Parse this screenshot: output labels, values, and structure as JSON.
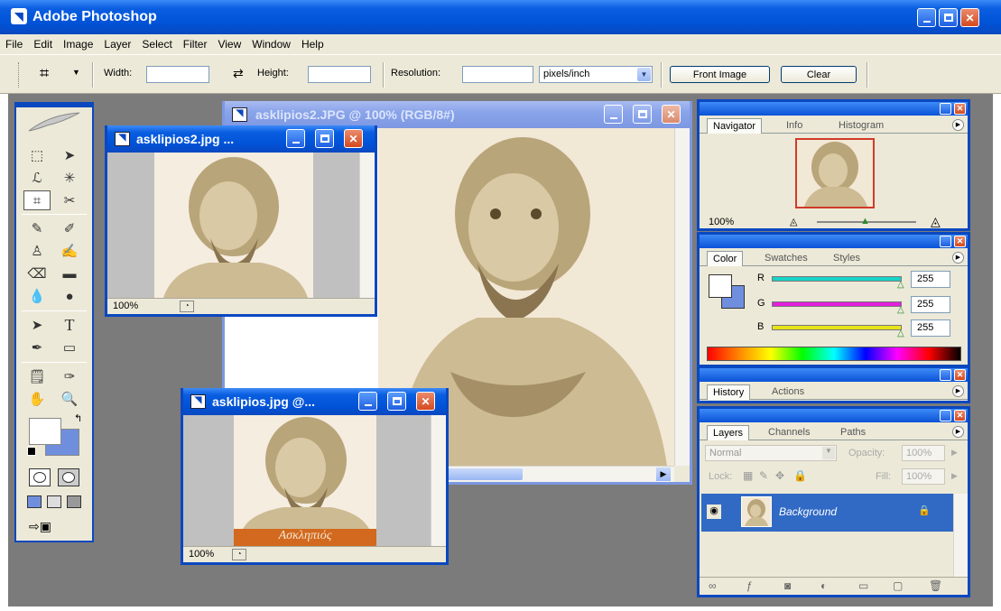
{
  "app": {
    "title": "Adobe Photoshop"
  },
  "menu": [
    "File",
    "Edit",
    "Image",
    "Layer",
    "Select",
    "Filter",
    "View",
    "Window",
    "Help"
  ],
  "options": {
    "width_label": "Width:",
    "height_label": "Height:",
    "resolution_label": "Resolution:",
    "units": "pixels/inch",
    "front_image": "Front Image",
    "clear": "Clear"
  },
  "documents": {
    "main": {
      "title": "asklipios2.JPG @ 100% (RGB/8#)"
    },
    "small1": {
      "title": "asklipios2.jpg ...",
      "zoom": "100%"
    },
    "small2": {
      "title": "asklipios.jpg @...",
      "zoom": "100%",
      "caption": "Ασκληπιός"
    }
  },
  "navigator": {
    "tabs": [
      "Navigator",
      "Info",
      "Histogram"
    ],
    "zoom": "100%"
  },
  "color": {
    "tabs": [
      "Color",
      "Swatches",
      "Styles"
    ],
    "channels": [
      {
        "label": "R",
        "value": "255",
        "color": "#19d2c8"
      },
      {
        "label": "G",
        "value": "255",
        "color": "#e21fdc"
      },
      {
        "label": "B",
        "value": "255",
        "color": "#e8e31a"
      }
    ]
  },
  "history": {
    "tabs": [
      "History",
      "Actions"
    ]
  },
  "layers": {
    "tabs": [
      "Layers",
      "Channels",
      "Paths"
    ],
    "blend_mode": "Normal",
    "opacity_label": "Opacity:",
    "opacity": "100%",
    "lock_label": "Lock:",
    "fill_label": "Fill:",
    "fill": "100%",
    "layer_name": "Background"
  }
}
